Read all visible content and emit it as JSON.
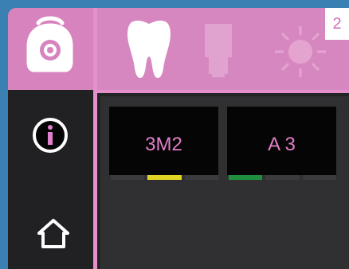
{
  "page_badge": "2",
  "sidebar": {
    "items": [
      {
        "name": "device-tab",
        "selected": true,
        "icon": "scanner-device-icon"
      },
      {
        "name": "info-button",
        "icon": "info-icon"
      },
      {
        "name": "home-button",
        "icon": "home-icon"
      }
    ]
  },
  "toolbar": {
    "icons": [
      "tooth-icon",
      "bottle-icon",
      "sun-icon"
    ]
  },
  "shades": [
    {
      "label": "3M2",
      "meter": {
        "active_index": 1,
        "segments": 3,
        "color": "#e0d524"
      }
    },
    {
      "label": "A 3",
      "meter": {
        "active_index": 0,
        "segments": 3,
        "color": "#1f8f3e"
      }
    }
  ],
  "colors": {
    "accent": "#d787c0",
    "accent_light": "#e58fcb",
    "panel": "#303032",
    "tile": "#050505",
    "text": "#e07fc9"
  }
}
